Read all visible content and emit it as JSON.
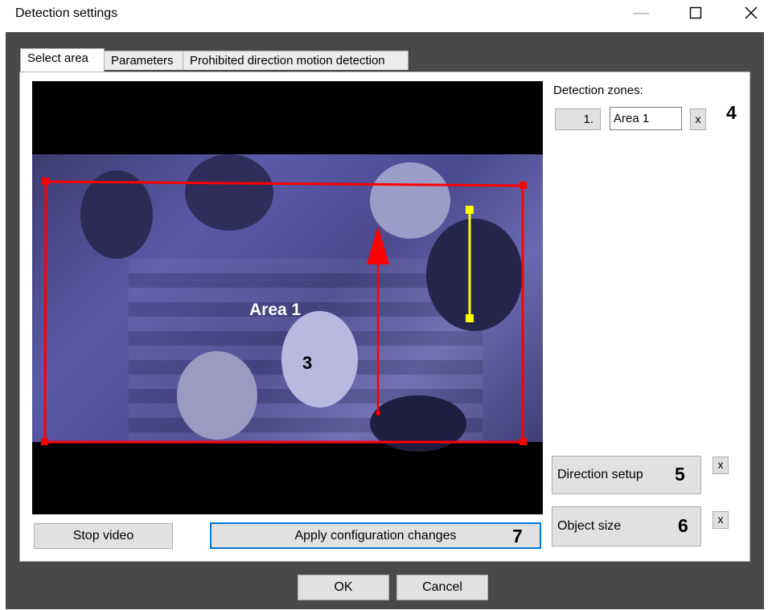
{
  "window": {
    "title": "Detection settings",
    "minimize_icon": "minimize-icon",
    "maximize_icon": "maximize-icon",
    "close_icon": "close-icon"
  },
  "tabs": [
    {
      "label": "Select area",
      "active": true
    },
    {
      "label": "Parameters",
      "active": false
    },
    {
      "label": "Prohibited direction motion detection",
      "active": false
    }
  ],
  "video": {
    "area_label": "Area 1",
    "marker_3": "3",
    "area_color": "#ff0000",
    "size_line_color": "#ffff00"
  },
  "zones": {
    "header": "Detection zones:",
    "items": [
      {
        "number": "1.",
        "name": "Area 1",
        "remove_label": "x"
      }
    ],
    "marker_4": "4"
  },
  "direction": {
    "label": "Direction setup",
    "marker": "5",
    "remove_label": "x"
  },
  "object_size": {
    "label": "Object size",
    "marker": "6",
    "remove_label": "x"
  },
  "controls": {
    "stop_video": "Stop video",
    "apply": "Apply configuration changes",
    "apply_marker": "7"
  },
  "footer": {
    "ok": "OK",
    "cancel": "Cancel"
  },
  "colors": {
    "focus_border": "#0078d7",
    "frame_bg": "#494949"
  }
}
